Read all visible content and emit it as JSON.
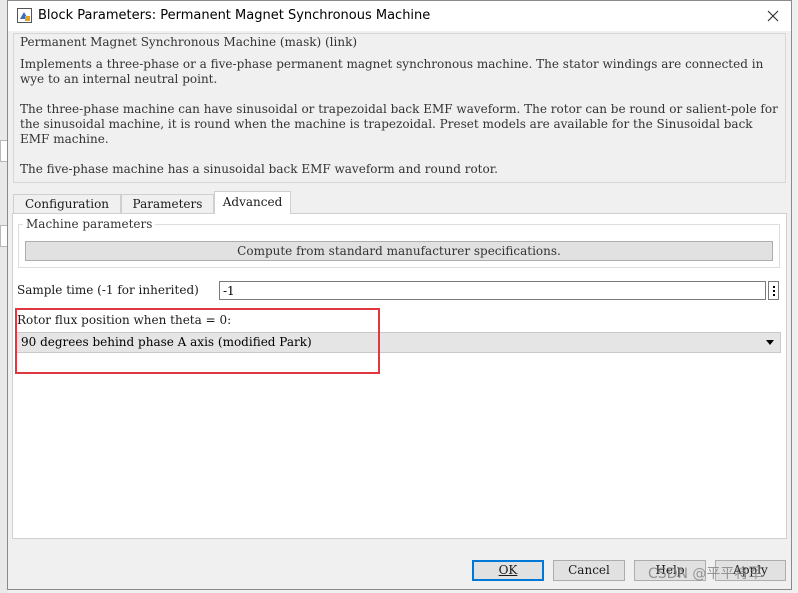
{
  "window": {
    "title": "Block Parameters: Permanent Magnet Synchronous Machine",
    "icon": "simulink-block-icon"
  },
  "mask": {
    "group_title": "Permanent Magnet Synchronous Machine (mask) (link)",
    "description": [
      "Implements a three-phase or a five-phase permanent magnet synchronous machine. The stator windings are connected in wye to an internal neutral point.",
      "The three-phase machine can have sinusoidal or trapezoidal back EMF waveform. The rotor can be round or salient-pole for the sinusoidal machine, it is round when the machine is trapezoidal. Preset models are available for the Sinusoidal back EMF machine.",
      "The five-phase machine has a sinusoidal back EMF waveform and round rotor."
    ]
  },
  "tabs": [
    {
      "label": "Configuration"
    },
    {
      "label": "Parameters"
    },
    {
      "label": "Advanced"
    }
  ],
  "active_tab": "Advanced",
  "advanced": {
    "machine_params_title": "Machine parameters",
    "compute_button": "Compute from standard manufacturer specifications.",
    "sample_time_label": "Sample time (-1 for inherited)",
    "sample_time_value": "-1",
    "rotor_flux_label": "Rotor flux position when theta = 0:",
    "rotor_flux_value": "90 degrees behind phase A axis (modified Park)"
  },
  "buttons": {
    "ok": "OK",
    "cancel": "Cancel",
    "help": "Help",
    "apply": "Apply"
  },
  "watermark": "CSDN @平平将军",
  "colors": {
    "highlight": "#e0383e",
    "primary_border": "#0078d7"
  }
}
